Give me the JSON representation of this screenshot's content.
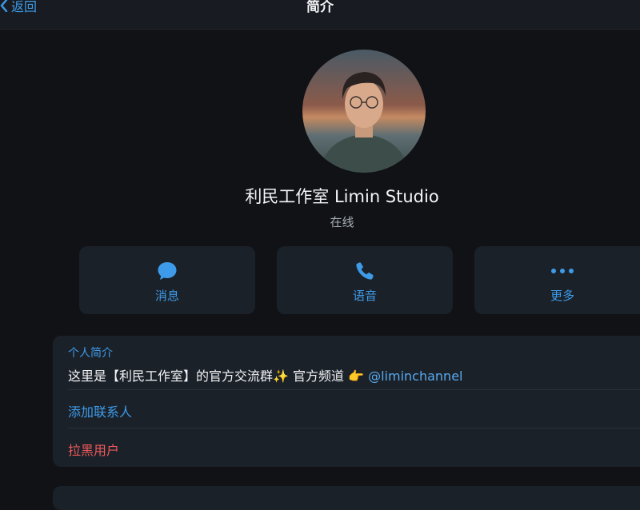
{
  "header": {
    "back_label": "返回",
    "title": "简介"
  },
  "profile": {
    "name": "利民工作室 Limin Studio",
    "status": "在线"
  },
  "actions": [
    {
      "label": "消息",
      "icon": "chat-bubble-icon"
    },
    {
      "label": "语音",
      "icon": "phone-icon"
    },
    {
      "label": "更多",
      "icon": "more-dots-icon"
    }
  ],
  "bio": {
    "label": "个人简介",
    "text": "这里是【利民工作室】的官方交流群✨ 官方频道 👉 ",
    "link": "@liminchannel"
  },
  "rows": {
    "add_contact": "添加联系人",
    "block_user": "拉黑用户"
  },
  "colors": {
    "accent": "#3d9be9",
    "danger": "#ef5a5a",
    "background": "#101216",
    "card": "#1b2129"
  }
}
